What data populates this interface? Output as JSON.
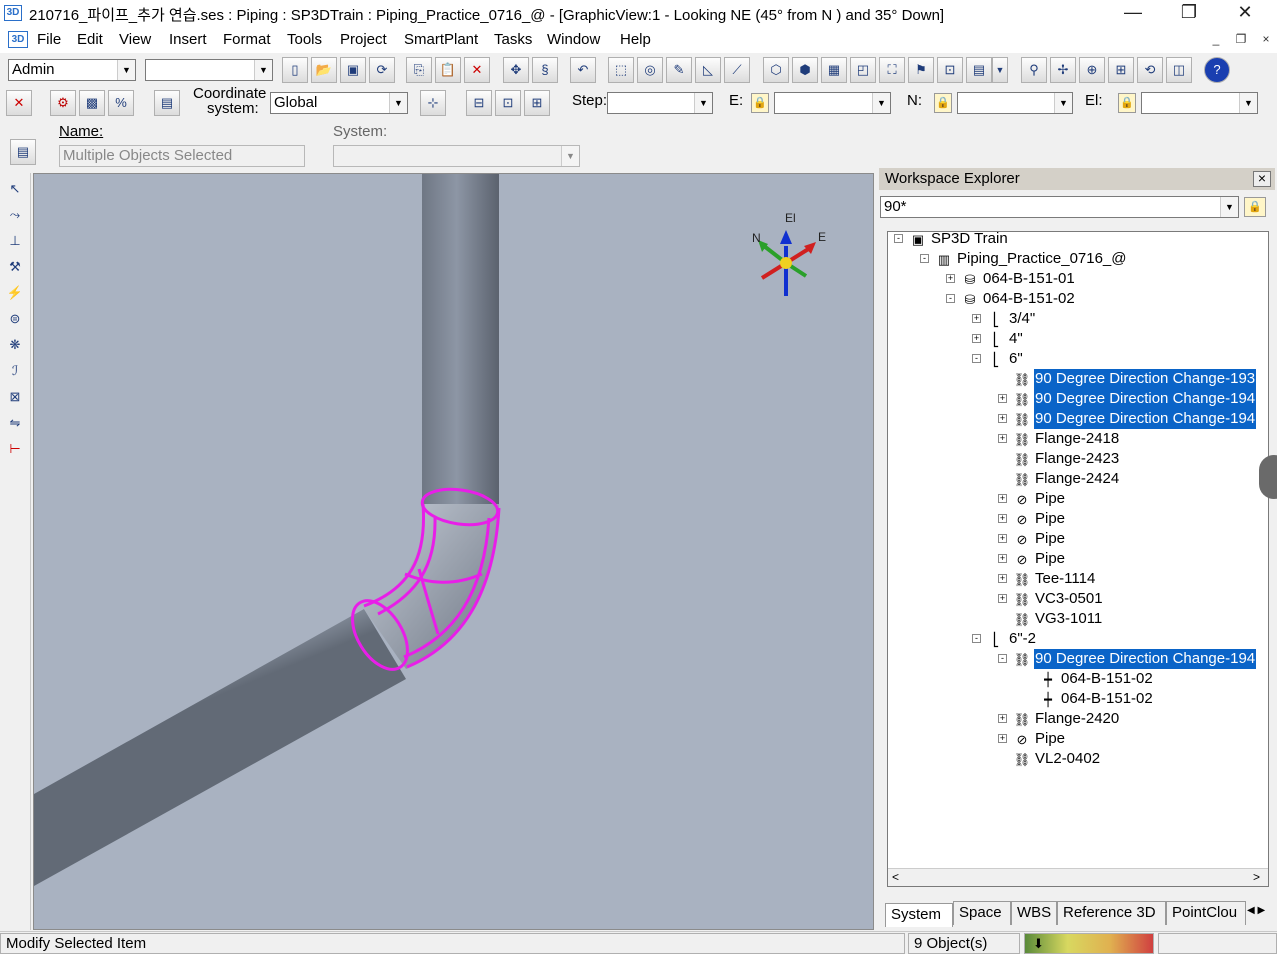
{
  "window": {
    "title": "210716_파이프_추가 연습.ses : Piping : SP3DTrain : Piping_Practice_0716_@ - [GraphicView:1 - Looking NE (45° from N ) and 35° Down]",
    "app_icon": "3D",
    "minimize": "—",
    "restore": "❐",
    "close": "✕"
  },
  "menubar": {
    "items": [
      "File",
      "Edit",
      "View",
      "Insert",
      "Format",
      "Tools",
      "Project",
      "SmartPlant",
      "Tasks",
      "Window",
      "Help"
    ],
    "mdi_minimize": "_",
    "mdi_restore": "❐",
    "mdi_close": "×"
  },
  "toolbar1": {
    "permission_group": "Admin",
    "filter_value": ""
  },
  "toolbar2": {
    "coordinate_label_line1": "Coordinate",
    "coordinate_label_line2": "system:",
    "coordinate_system": "Global",
    "step_label": "Step:",
    "step_value": "",
    "e_label": "E:",
    "e_value": "",
    "n_label": "N:",
    "n_value": "",
    "el_label": "El:",
    "el_value": ""
  },
  "properties_bar": {
    "name_label": "Name:",
    "name_value": "Multiple Objects Selected",
    "system_label": "System:",
    "system_value": ""
  },
  "compass": {
    "up_label": "El",
    "north_label": "N",
    "east_label": "E"
  },
  "workspace_explorer": {
    "title": "Workspace Explorer",
    "filter_value": "90*",
    "tree": [
      {
        "label": "SP3D Train",
        "level": 0,
        "expander": "-",
        "icon": "workspace-icon",
        "selected": false
      },
      {
        "label": "Piping_Practice_0716_@",
        "level": 1,
        "expander": "-",
        "icon": "plant-icon",
        "selected": false
      },
      {
        "label": "064-B-151-01",
        "level": 2,
        "expander": "+",
        "icon": "pipeline-icon",
        "selected": false
      },
      {
        "label": "064-B-151-02",
        "level": 2,
        "expander": "-",
        "icon": "pipeline-icon",
        "selected": false
      },
      {
        "label": "3/4\"",
        "level": 3,
        "expander": "+",
        "icon": "pipe-run-icon",
        "selected": false
      },
      {
        "label": "4\"",
        "level": 3,
        "expander": "+",
        "icon": "pipe-run-icon",
        "selected": false
      },
      {
        "label": "6\"",
        "level": 3,
        "expander": "-",
        "icon": "pipe-run-icon",
        "selected": false
      },
      {
        "label": "90 Degree Direction Change-193",
        "level": 4,
        "expander": "",
        "icon": "feature-icon",
        "selected": true
      },
      {
        "label": "90 Degree Direction Change-194",
        "level": 4,
        "expander": "+",
        "icon": "feature-icon",
        "selected": true
      },
      {
        "label": "90 Degree Direction Change-194",
        "level": 4,
        "expander": "+",
        "icon": "feature-icon",
        "selected": true
      },
      {
        "label": "Flange-2418",
        "level": 4,
        "expander": "+",
        "icon": "feature-icon",
        "selected": false
      },
      {
        "label": "Flange-2423",
        "level": 4,
        "expander": "",
        "icon": "feature-icon",
        "selected": false
      },
      {
        "label": "Flange-2424",
        "level": 4,
        "expander": "",
        "icon": "feature-icon",
        "selected": false
      },
      {
        "label": "Pipe",
        "level": 4,
        "expander": "+",
        "icon": "pipe-icon",
        "selected": false
      },
      {
        "label": "Pipe",
        "level": 4,
        "expander": "+",
        "icon": "pipe-icon",
        "selected": false
      },
      {
        "label": "Pipe",
        "level": 4,
        "expander": "+",
        "icon": "pipe-icon",
        "selected": false
      },
      {
        "label": "Pipe",
        "level": 4,
        "expander": "+",
        "icon": "pipe-icon",
        "selected": false
      },
      {
        "label": "Tee-1114",
        "level": 4,
        "expander": "+",
        "icon": "feature-icon",
        "selected": false
      },
      {
        "label": "VC3-0501",
        "level": 4,
        "expander": "+",
        "icon": "feature-icon",
        "selected": false
      },
      {
        "label": "VG3-1011",
        "level": 4,
        "expander": "",
        "icon": "feature-icon",
        "selected": false
      },
      {
        "label": "6\"-2",
        "level": 3,
        "expander": "-",
        "icon": "pipe-run-icon",
        "selected": false
      },
      {
        "label": "90 Degree Direction Change-194",
        "level": 4,
        "expander": "-",
        "icon": "feature-icon",
        "selected": true
      },
      {
        "label": "064-B-151-02",
        "level": 5,
        "expander": "",
        "icon": "connection-icon",
        "selected": false
      },
      {
        "label": "064-B-151-02",
        "level": 5,
        "expander": "",
        "icon": "connection-icon",
        "selected": false
      },
      {
        "label": "Flange-2420",
        "level": 4,
        "expander": "+",
        "icon": "feature-icon",
        "selected": false
      },
      {
        "label": "Pipe",
        "level": 4,
        "expander": "+",
        "icon": "pipe-icon",
        "selected": false
      },
      {
        "label": "VL2-0402",
        "level": 4,
        "expander": "",
        "icon": "feature-icon",
        "selected": false
      }
    ],
    "tabs": [
      "System",
      "Space",
      "WBS",
      "Reference 3D",
      "PointClou"
    ],
    "active_tab": "System"
  },
  "statusbar": {
    "message": "Modify Selected Item",
    "object_count": "9 Object(s)"
  },
  "colors": {
    "viewport_bg": "#a9b2c1",
    "selection_highlight": "#0a64c8",
    "selected_geometry": "#e81ee8"
  }
}
